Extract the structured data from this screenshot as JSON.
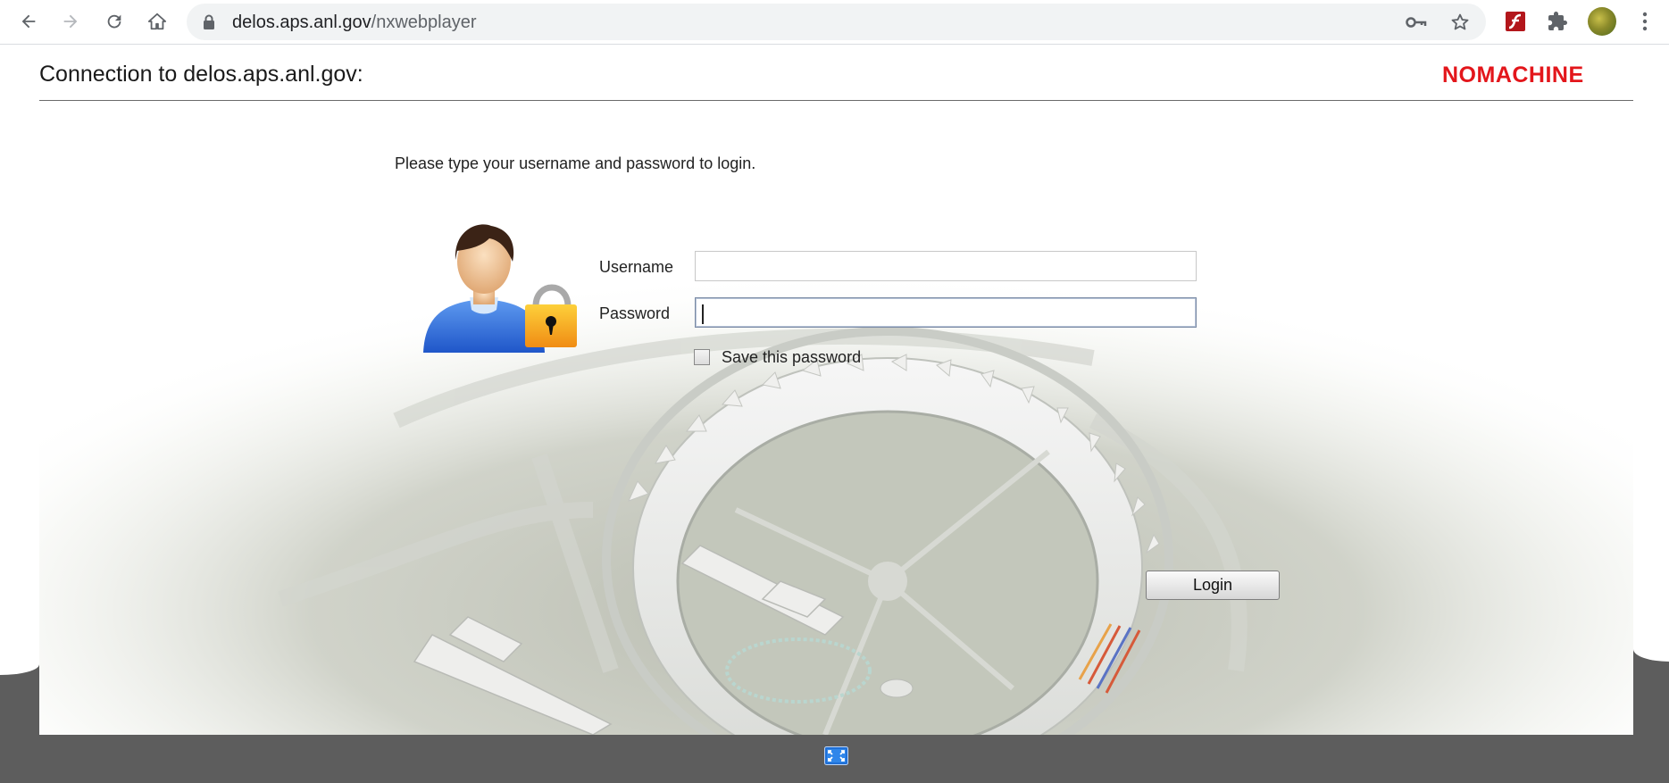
{
  "browser": {
    "url_host": "delos.aps.anl.gov",
    "url_path": "/nxwebplayer"
  },
  "page": {
    "connection_title": "Connection to delos.aps.anl.gov:",
    "logo_text": "NOMACHINE",
    "instruction": "Please type your username and password to login.",
    "username_label": "Username",
    "username_value": "",
    "password_label": "Password",
    "password_value": "",
    "save_password_label": "Save this password",
    "save_password_checked": false,
    "login_label": "Login"
  },
  "colors": {
    "brand": "#e3161b",
    "frame": "#5d5d5d",
    "fullscreen_icon": "#1f6fd6"
  },
  "icons": [
    "back-icon",
    "forward-icon",
    "reload-icon",
    "home-icon",
    "lock-icon",
    "key-icon",
    "star-icon",
    "flash-extension-icon",
    "puzzle-icon",
    "avatar",
    "more-icon",
    "user-lock-icon",
    "fullscreen-icon"
  ]
}
